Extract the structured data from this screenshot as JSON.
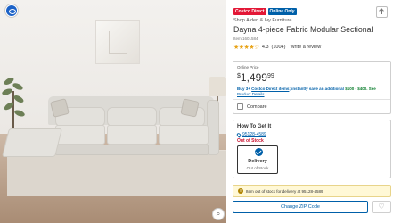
{
  "badges": {
    "costco_direct": "Costco Direct",
    "online_only": "Online Only"
  },
  "product": {
    "byline": "Shop Alden & Ivy Furniture",
    "title": "Dayna 4-piece Fabric Modular Sectional",
    "item_number": "Item 1601584",
    "rating_value": "4.3",
    "rating_count": "(1004)",
    "stars_filled": 4.3,
    "stars_max": 5,
    "write_review": "Write a review"
  },
  "pricing": {
    "label": "Online Price",
    "currency": "$",
    "dollars": "1,499",
    "cents": "99",
    "promo_prefix": "Buy 3+",
    "promo_link": "Costco Direct items",
    "promo_middle": "; instantly save an additional",
    "promo_savings": "$100 - $400.",
    "promo_see": "See",
    "promo_details": "Product Details",
    "compare_label": "Compare"
  },
  "fulfillment": {
    "heading": "How To Get It",
    "zip": "95128-4589",
    "status": "Out of Stock",
    "delivery_title": "Delivery",
    "delivery_status": "Out of Stock"
  },
  "alert": {
    "text": "Item out of stock for delivery at 95128-4589"
  },
  "actions": {
    "change_zip": "Change ZIP Code",
    "favorite_icon": "♡",
    "zoom_icon": "⌕"
  },
  "colors": {
    "costco_red": "#e31837",
    "costco_blue": "#0060a9",
    "star_gold": "#e8a317",
    "out_of_stock_red": "#c8102e",
    "promo_green": "#0a7d2c"
  }
}
